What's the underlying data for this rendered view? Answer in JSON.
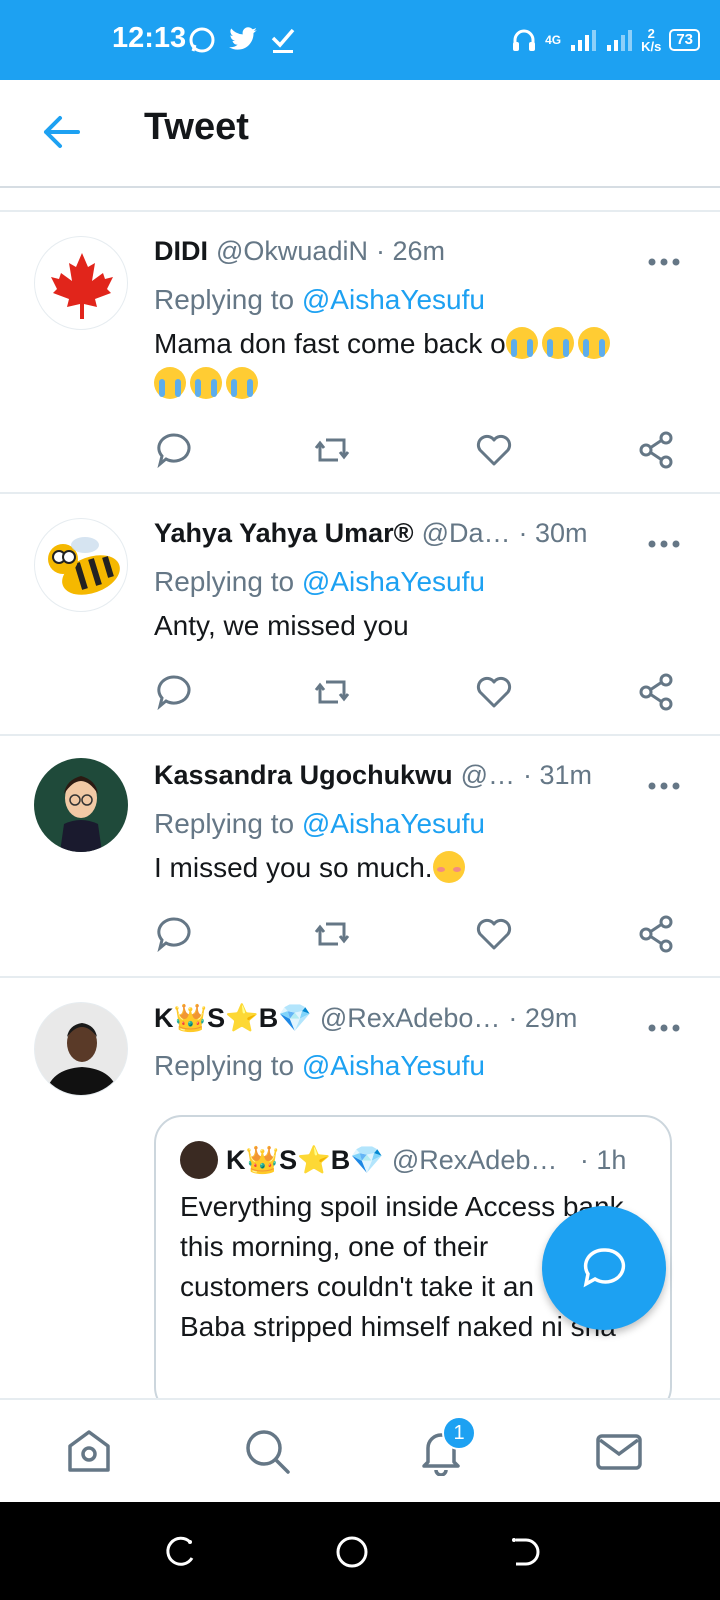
{
  "status_bar": {
    "time": "12:13",
    "network": "4G",
    "speed_value": "2",
    "speed_unit": "K/s",
    "battery": "73"
  },
  "app_bar": {
    "title": "Tweet"
  },
  "tweets": [
    {
      "name": "DIDI",
      "handle": "@OkwuadiN",
      "time": "· 26m",
      "replying_prefix": "Replying to ",
      "replying_to": "@AishaYesufu",
      "text": "Mama don fast come back o",
      "emoji": [
        "loudly-crying-face",
        "loudly-crying-face",
        "loudly-crying-face",
        "loudly-crying-face",
        "loudly-crying-face",
        "loudly-crying-face"
      ],
      "avatar_icon": "maple-leaf-icon"
    },
    {
      "name": "Yahya Yahya Umar®",
      "handle": "@Da…",
      "time": "· 30m",
      "replying_prefix": "Replying to ",
      "replying_to": "@AishaYesufu",
      "text": "Anty, we missed you",
      "avatar_icon": "bee-icon"
    },
    {
      "name": "Kassandra Ugochukwu",
      "handle": "@…",
      "time": "· 31m",
      "replying_prefix": "Replying to ",
      "replying_to": "@AishaYesufu",
      "text": "I missed you so much.",
      "emoji": [
        "smiling-face-with-smiling-eyes"
      ],
      "avatar_icon": "bitmoji-avatar"
    },
    {
      "name": "K👑S⭐B💎",
      "handle": "@RexAdebo…",
      "time": "· 29m",
      "replying_prefix": "Replying to ",
      "replying_to": "@AishaYesufu",
      "avatar_icon": "person-photo-avatar",
      "quote": {
        "name": "K👑S⭐B💎",
        "handle": "@RexAdebo…",
        "time": "· 1h",
        "lines": [
          "Everything spoil inside Access bank",
          "this morning, one of their",
          "customers couldn't take it an",
          "Baba stripped himself naked ni sha"
        ]
      }
    }
  ],
  "tab_bar": {
    "items": [
      "home-icon",
      "search-icon",
      "notifications-icon",
      "messages-icon"
    ],
    "notification_count": "1"
  },
  "colors": {
    "accent": "#1da1f2",
    "secondary_text": "#657786",
    "primary_text": "#14171a"
  }
}
